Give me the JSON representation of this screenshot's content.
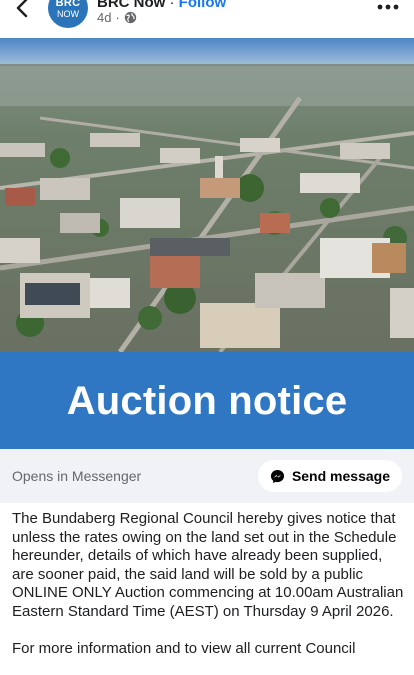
{
  "header": {
    "avatar_line1": "BRC",
    "avatar_line2": "NOW",
    "page_name": "BRC Now",
    "separator": "·",
    "follow_label": "Follow",
    "time_ago": "4d",
    "privacy_icon": "globe-icon",
    "back_icon": "chevron-left-icon",
    "more_icon": "more-horizontal-icon"
  },
  "post": {
    "image_alt": "Aerial view of Bundaberg",
    "banner_text": "Auction notice",
    "opens_in": "Opens in Messenger",
    "send_message_label": "Send message",
    "send_icon": "messenger-icon",
    "paragraph_1": "The Bundaberg Regional Council hereby gives notice that unless the rates owing on the land set out in the Schedule hereunder, details of which have already been supplied, are sooner paid, the said land will be sold by a public ONLINE ONLY Auction commencing at 10.00am Australian Eastern Standard Time (AEST) on Thursday 9 April 2026.",
    "paragraph_2": "For more information and to view all current Council"
  },
  "colors": {
    "banner_blue": "#2f76c3",
    "follow_blue": "#1877f2",
    "avatar_blue": "#2b74b9",
    "bar_gray": "#f0f2f5"
  }
}
